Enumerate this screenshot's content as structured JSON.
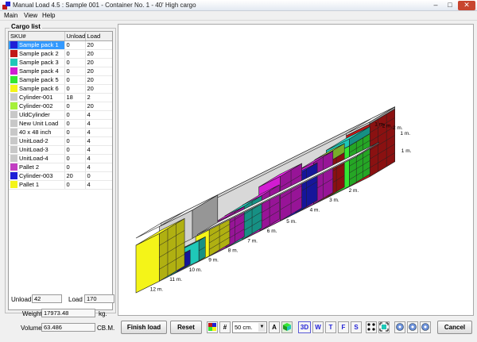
{
  "window": {
    "title": "Manual Load 4.5 : Sample 001 - Container No. 1 - 40' High cargo"
  },
  "menu": {
    "main": "Main",
    "view": "View",
    "help": "Help"
  },
  "cargo_list": {
    "group_title": "Cargo list",
    "headers": {
      "sku": "SKU#",
      "unload": "Unload",
      "load": "Load"
    },
    "rows": [
      {
        "name": "Sample pack 1",
        "unload": "0",
        "load": "20",
        "color": "#1f1fd6",
        "selected": true
      },
      {
        "name": "Sample pack 2",
        "unload": "0",
        "load": "20",
        "color": "#c01818"
      },
      {
        "name": "Sample pack 3",
        "unload": "0",
        "load": "20",
        "color": "#1fc8b8"
      },
      {
        "name": "Sample pack 4",
        "unload": "0",
        "load": "20",
        "color": "#d21cd2"
      },
      {
        "name": "Sample pack 5",
        "unload": "0",
        "load": "20",
        "color": "#33e633"
      },
      {
        "name": "Sample pack 6",
        "unload": "0",
        "load": "20",
        "color": "#f4f418"
      },
      {
        "name": "Cylinder-001",
        "unload": "18",
        "load": "2",
        "color": "#c8c8c8"
      },
      {
        "name": "Cylinder-002",
        "unload": "0",
        "load": "20",
        "color": "#a6f03a"
      },
      {
        "name": "UldCylinder",
        "unload": "0",
        "load": "4",
        "color": "#c8c8c8"
      },
      {
        "name": "New Unit Load",
        "unload": "0",
        "load": "4",
        "color": "#c8c8c8"
      },
      {
        "name": "40 x 48 inch",
        "unload": "0",
        "load": "4",
        "color": "#c8c8c8"
      },
      {
        "name": "UnitLoad-2",
        "unload": "0",
        "load": "4",
        "color": "#c8c8c8"
      },
      {
        "name": "UnitLoad-3",
        "unload": "0",
        "load": "4",
        "color": "#c8c8c8"
      },
      {
        "name": "UnitLoad-4",
        "unload": "0",
        "load": "4",
        "color": "#c8c8c8"
      },
      {
        "name": "Pallet 2",
        "unload": "0",
        "load": "4",
        "color": "#c23ec2"
      },
      {
        "name": "Cylinder-003",
        "unload": "20",
        "load": "0",
        "color": "#1f1fd6"
      },
      {
        "name": "Pallet 1",
        "unload": "0",
        "load": "4",
        "color": "#f4f418"
      }
    ]
  },
  "summary": {
    "unload_label": "Unload",
    "unload_value": "42",
    "load_label": "Load",
    "load_value": "170",
    "weight_label": "Weight",
    "weight_value": "17973.48",
    "weight_unit": "kg.",
    "volume_label": "Volume",
    "volume_value": "63.486",
    "volume_unit": "CB.M."
  },
  "viewport": {
    "meter_labels": [
      "1 m.",
      "2 m.",
      "2 m.",
      "1 m.",
      "1 m.",
      "2 m.",
      "3 m.",
      "4 m.",
      "5 m.",
      "6 m.",
      "7 m.",
      "8 m.",
      "9 m.",
      "10 m.",
      "11 m.",
      "12 m."
    ]
  },
  "toolbar": {
    "finish_label": "Finish load",
    "reset_label": "Reset",
    "grid_select_value": "50 cm.",
    "text_a": "A",
    "view_3d": "3D",
    "view_w": "W",
    "view_t": "T",
    "view_f": "F",
    "view_s": "S",
    "cancel_label": "Cancel"
  },
  "colors": {
    "container_grey": "#c8c8c8",
    "blue": "#1f1fd6",
    "red": "#c01818",
    "cyan": "#1fc8b8",
    "magenta": "#d21cd2",
    "green": "#33e633",
    "yellow": "#f4f418",
    "lime": "#a6f03a"
  }
}
